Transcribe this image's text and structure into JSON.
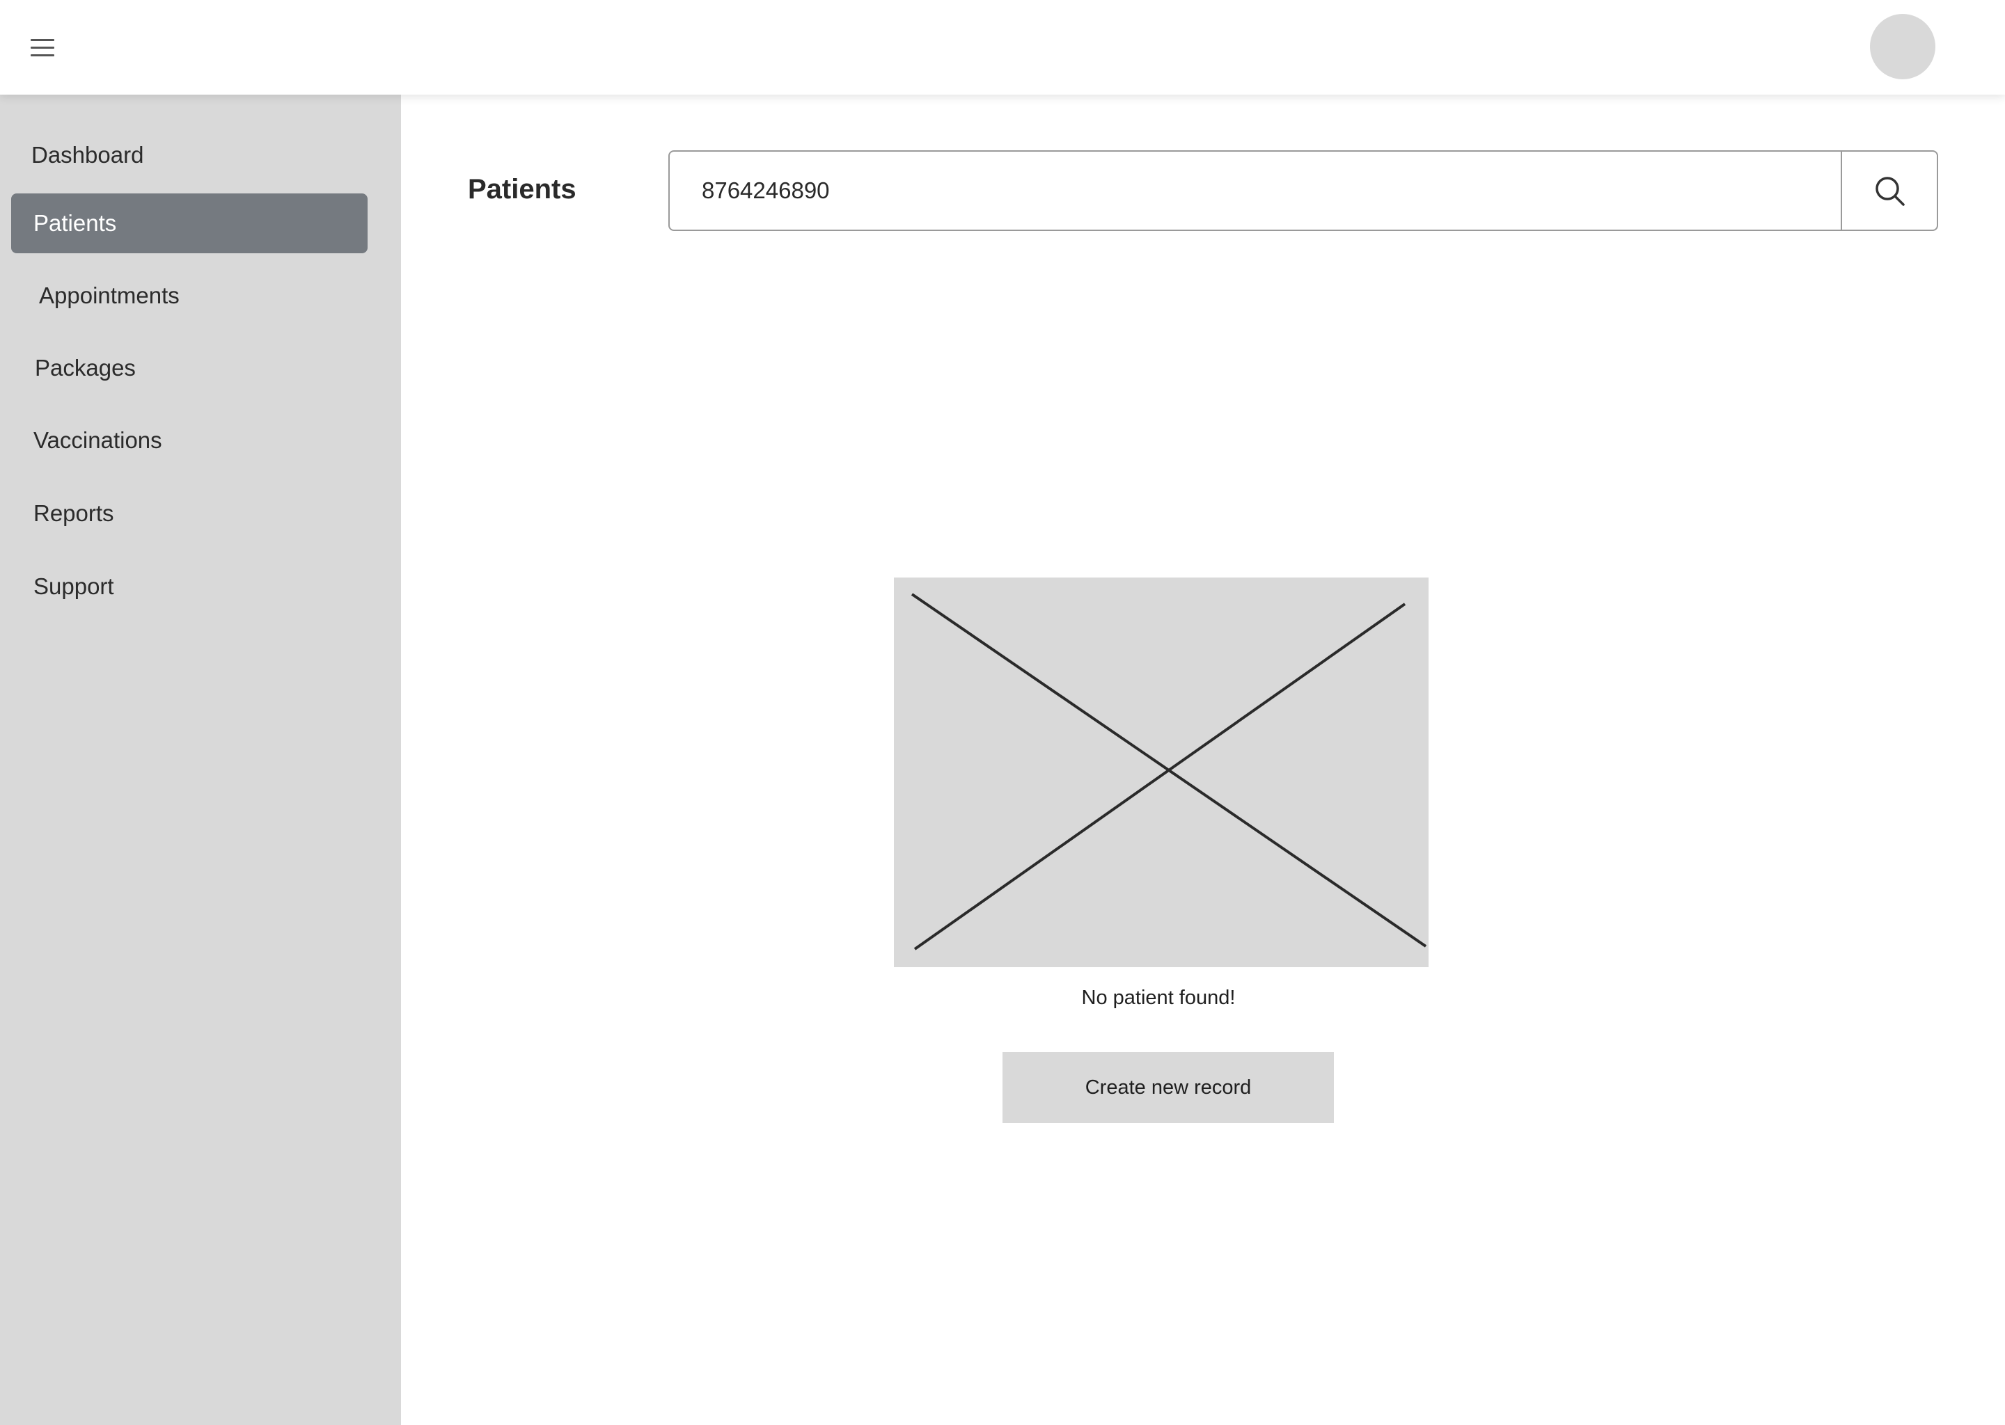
{
  "header": {
    "menu_icon": "hamburger-menu-icon",
    "avatar_icon": "user-avatar"
  },
  "sidebar": {
    "items": [
      {
        "label": "Dashboard",
        "active": false
      },
      {
        "label": "Patients",
        "active": true
      },
      {
        "label": "Appointments",
        "active": false
      },
      {
        "label": "Packages",
        "active": false
      },
      {
        "label": "Vaccinations",
        "active": false
      },
      {
        "label": "Reports",
        "active": false
      },
      {
        "label": "Support",
        "active": false
      }
    ]
  },
  "main": {
    "title": "Patients",
    "search": {
      "value": "8764246890",
      "icon": "search-icon"
    },
    "empty_state": {
      "image": "image-placeholder",
      "message": "No patient found!",
      "button_label": "Create new record"
    }
  },
  "colors": {
    "sidebar_bg": "#d9d9d9",
    "active_item_bg": "#757a80",
    "active_item_text": "#ffffff",
    "placeholder_bg": "#d9d9d9"
  }
}
